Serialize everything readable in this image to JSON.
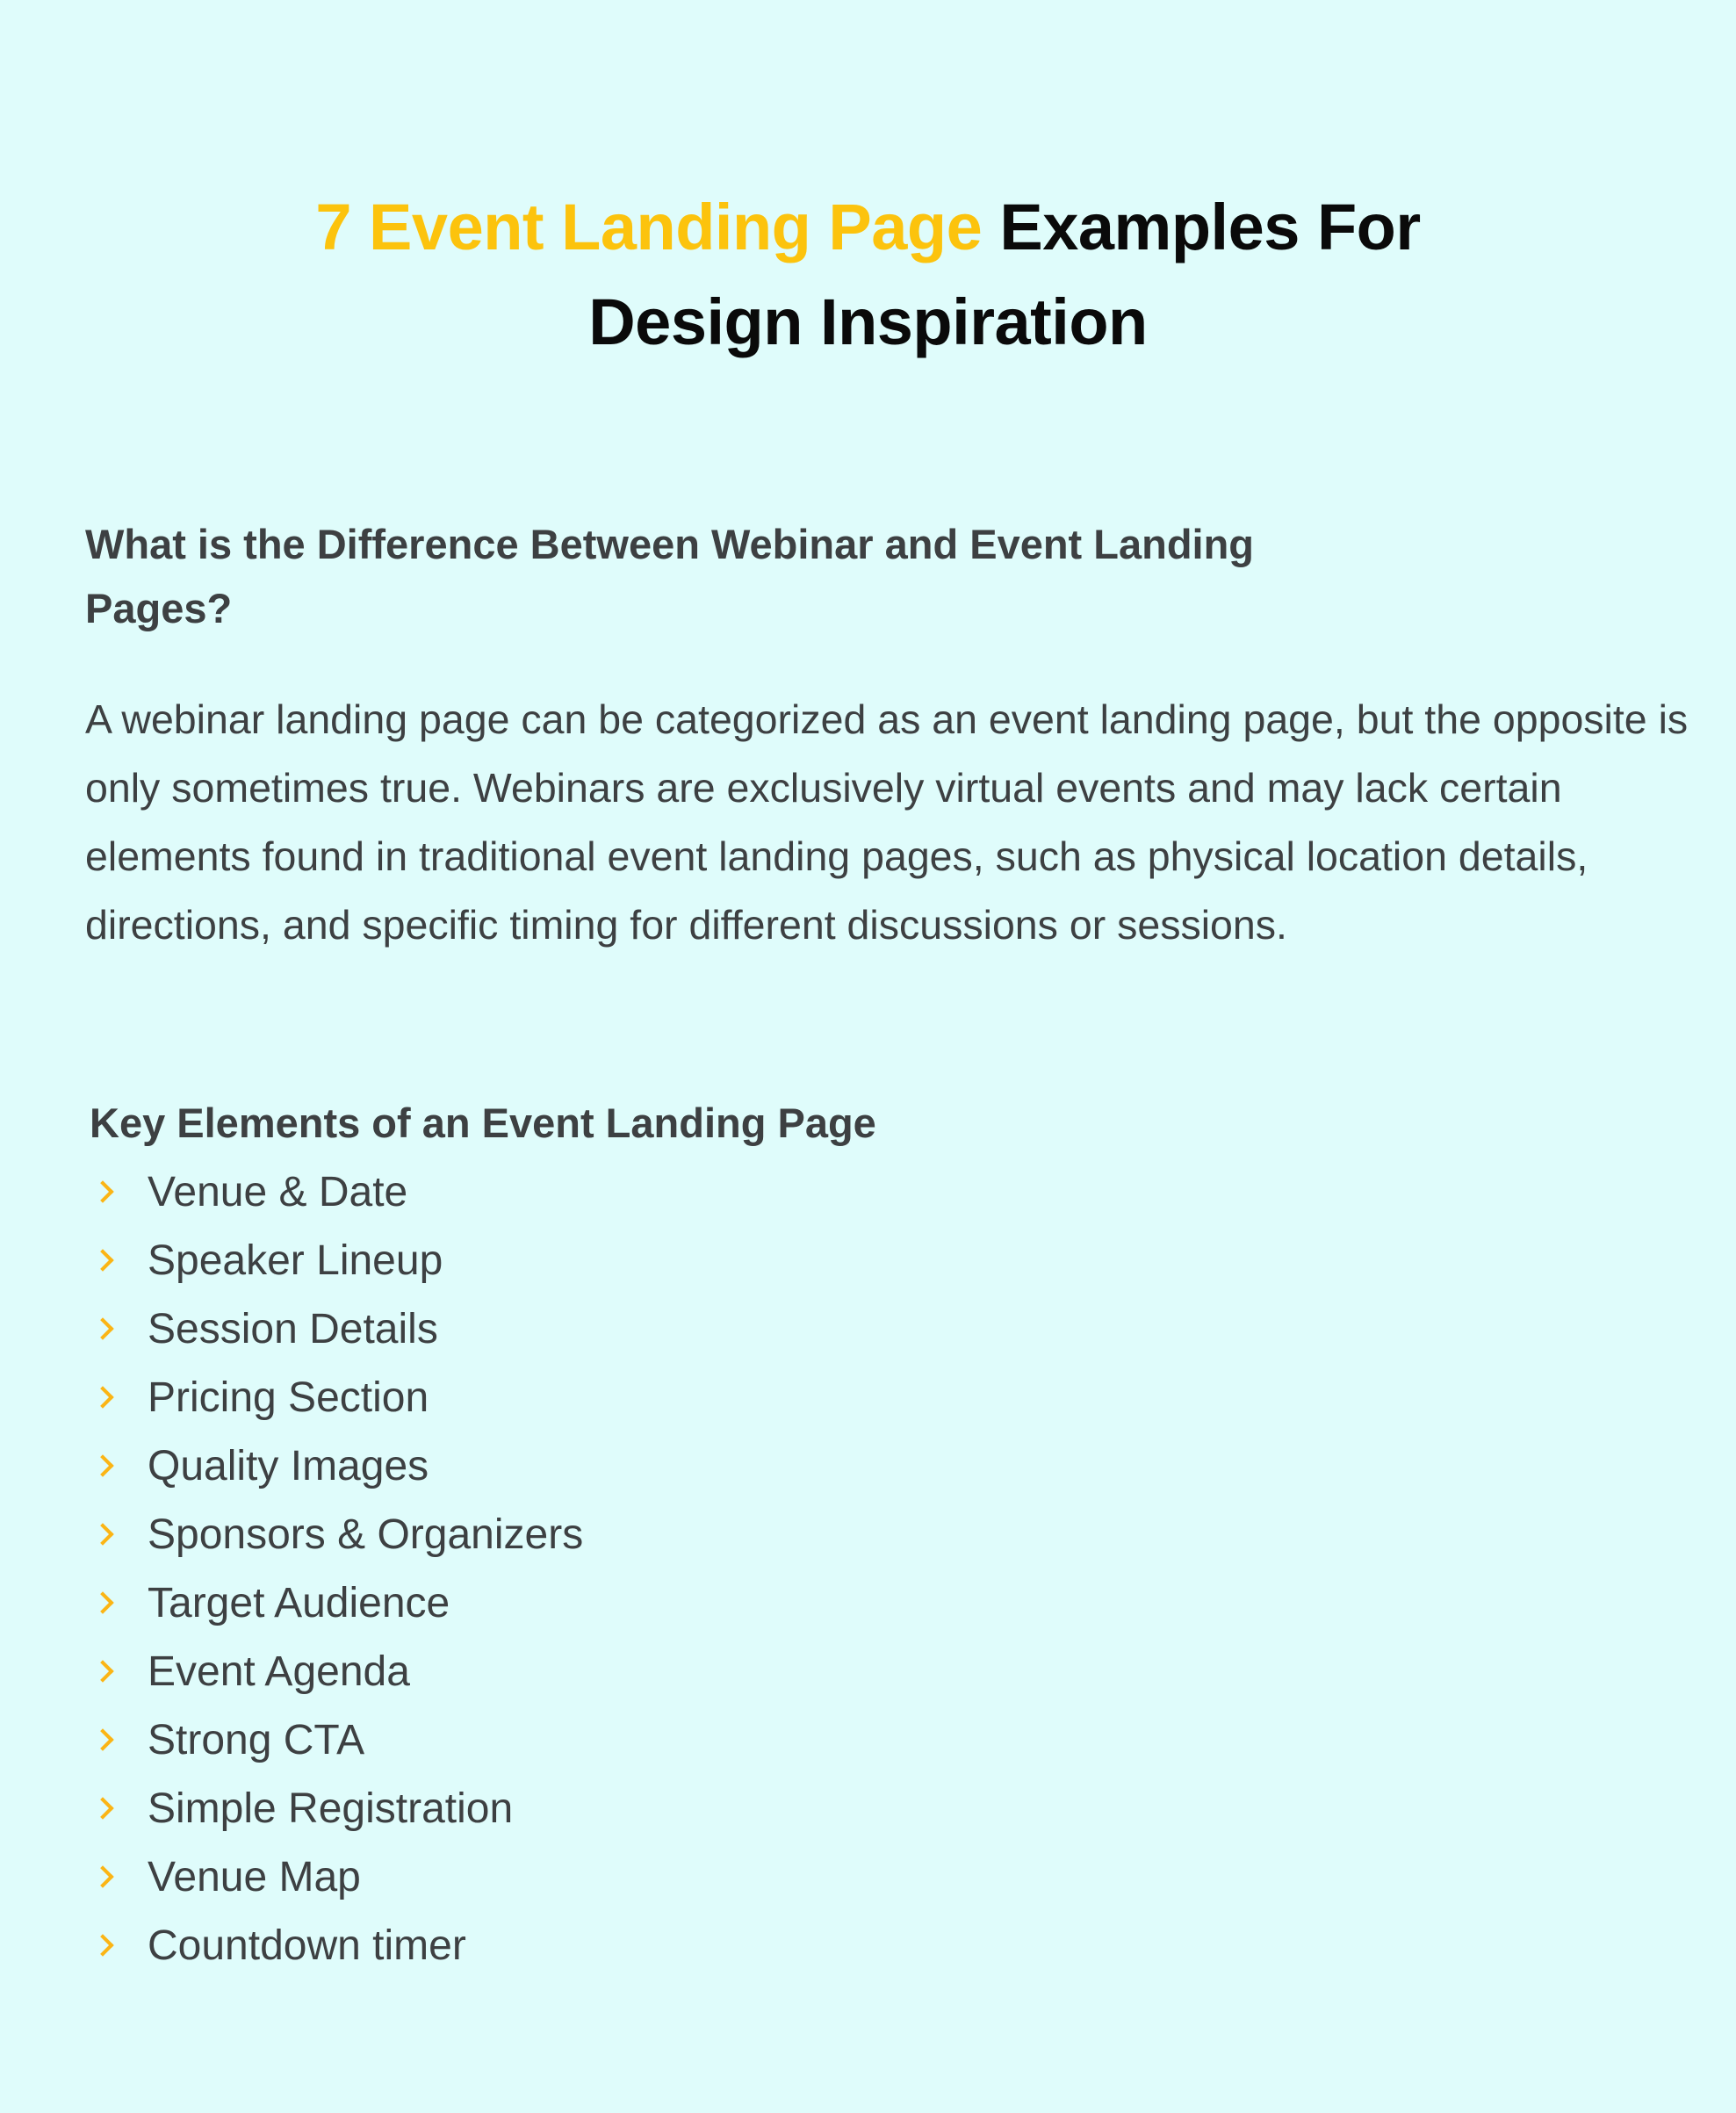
{
  "title": {
    "accent_text": "7 Event Landing Page",
    "rest_line1": " Examples For",
    "line2": "Design Inspiration",
    "accent_color": "#fcc30d"
  },
  "question_heading": "What is the Difference Between Webinar and Event Landing Pages?",
  "paragraph": "A webinar landing page can be categorized as an event landing page, but the opposite is only sometimes true. Webinars are exclusively virtual events and may lack certain elements found in traditional event landing pages, such as physical location details, directions, and specific timing for different discussions or sessions.",
  "key_elements": {
    "heading": "Key Elements of an Event Landing Page",
    "bullet_icon": "chevron-right-icon",
    "bullet_color": "#fbb515",
    "items": [
      "Venue & Date",
      "Speaker Lineup",
      "Session Details",
      "Pricing Section",
      "Quality Images",
      "Sponsors & Organizers",
      "Target Audience",
      "Event Agenda",
      "Strong CTA",
      "Simple Registration",
      "Venue Map",
      "Countdown timer"
    ]
  }
}
